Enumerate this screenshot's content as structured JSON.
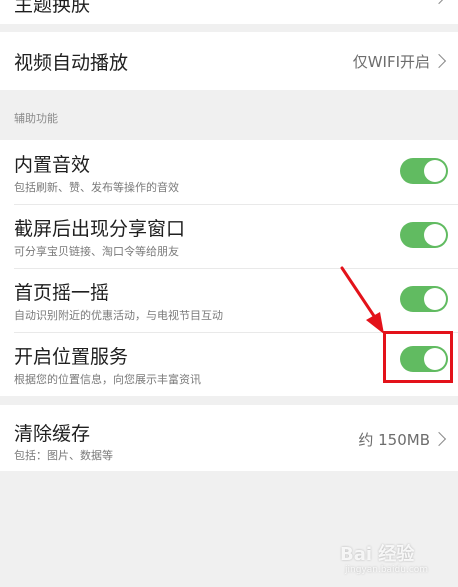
{
  "top_row": {
    "title": "主题换肤"
  },
  "video_row": {
    "title": "视频自动播放",
    "value": "仅WIFI开启"
  },
  "section": {
    "label": "辅助功能"
  },
  "settings": [
    {
      "title": "内置音效",
      "subtitle": "包括刷新、赞、发布等操作的音效",
      "enabled": true
    },
    {
      "title": "截屏后出现分享窗口",
      "subtitle": "可分享宝贝链接、淘口令等给朋友",
      "enabled": true
    },
    {
      "title": "首页摇一摇",
      "subtitle": "自动识别附近的优惠活动，与电视节目互动",
      "enabled": true
    },
    {
      "title": "开启位置服务",
      "subtitle": "根据您的位置信息，向您展示丰富资讯",
      "enabled": true
    }
  ],
  "cache_row": {
    "title": "清除缓存",
    "subtitle": "包括：图片、数据等",
    "value": "约 150MB"
  },
  "watermark": {
    "text": "Bai 经验",
    "url": "jingyan.baidu.com"
  },
  "colors": {
    "toggle_on": "#61bb61",
    "highlight": "#e3121a",
    "background": "#f0f0f0"
  }
}
